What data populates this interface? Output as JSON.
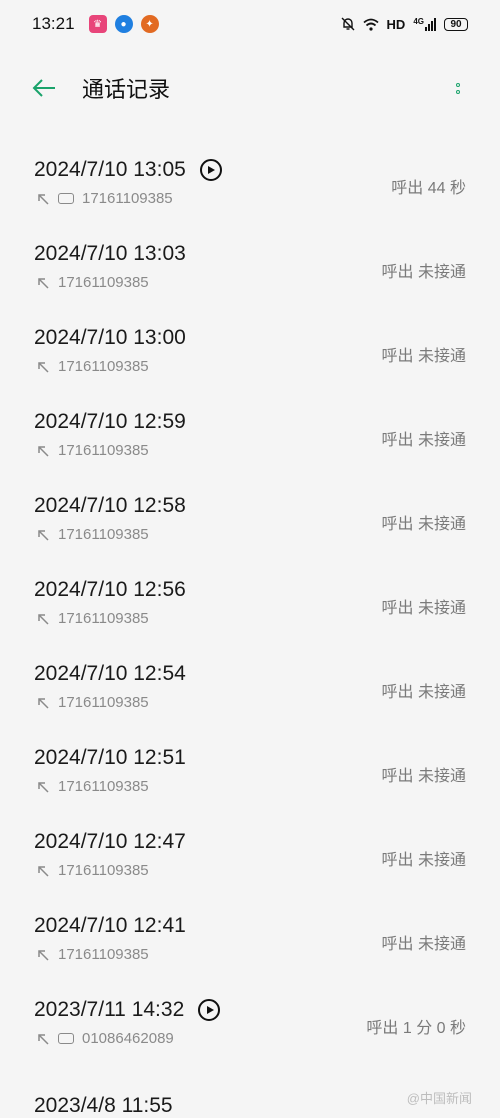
{
  "status_bar": {
    "time": "13:21",
    "network": "HD",
    "signal": "4G",
    "battery": "90"
  },
  "header": {
    "title": "通话记录"
  },
  "calls": [
    {
      "datetime": "2024/7/10 13:05",
      "number": "17161109385",
      "status": "呼出  44 秒",
      "recording": true,
      "sim": true
    },
    {
      "datetime": "2024/7/10 13:03",
      "number": "17161109385",
      "status": "呼出 未接通",
      "recording": false,
      "sim": false
    },
    {
      "datetime": "2024/7/10 13:00",
      "number": "17161109385",
      "status": "呼出 未接通",
      "recording": false,
      "sim": false
    },
    {
      "datetime": "2024/7/10 12:59",
      "number": "17161109385",
      "status": "呼出 未接通",
      "recording": false,
      "sim": false
    },
    {
      "datetime": "2024/7/10 12:58",
      "number": "17161109385",
      "status": "呼出 未接通",
      "recording": false,
      "sim": false
    },
    {
      "datetime": "2024/7/10 12:56",
      "number": "17161109385",
      "status": "呼出 未接通",
      "recording": false,
      "sim": false
    },
    {
      "datetime": "2024/7/10 12:54",
      "number": "17161109385",
      "status": "呼出 未接通",
      "recording": false,
      "sim": false
    },
    {
      "datetime": "2024/7/10 12:51",
      "number": "17161109385",
      "status": "呼出 未接通",
      "recording": false,
      "sim": false
    },
    {
      "datetime": "2024/7/10 12:47",
      "number": "17161109385",
      "status": "呼出 未接通",
      "recording": false,
      "sim": false
    },
    {
      "datetime": "2024/7/10 12:41",
      "number": "17161109385",
      "status": "呼出 未接通",
      "recording": false,
      "sim": false
    },
    {
      "datetime": "2023/7/11 14:32",
      "number": "01086462089",
      "status": "呼出  1 分 0 秒",
      "recording": true,
      "sim": true
    }
  ],
  "partial": {
    "datetime": "2023/4/8 11:55"
  },
  "watermark": "@中国新闻",
  "colors": {
    "accent": "#1aa36b",
    "background": "#f5f5f5"
  }
}
